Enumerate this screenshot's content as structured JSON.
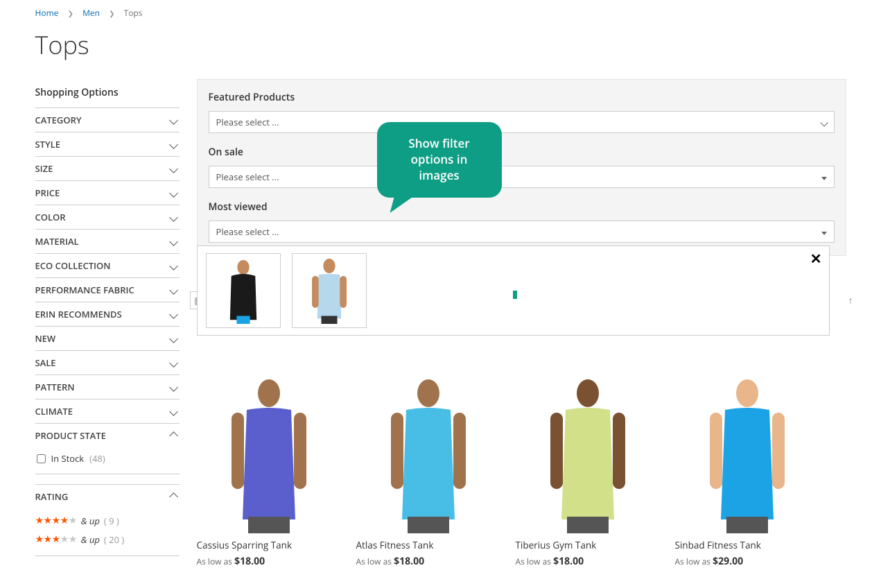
{
  "breadcrumb": {
    "home": "Home",
    "men": "Men",
    "current": "Tops"
  },
  "title": "Tops",
  "sidebar": {
    "heading": "Shopping Options",
    "filters": [
      {
        "label": "CATEGORY",
        "expanded": false
      },
      {
        "label": "STYLE",
        "expanded": false
      },
      {
        "label": "SIZE",
        "expanded": false
      },
      {
        "label": "PRICE",
        "expanded": false
      },
      {
        "label": "COLOR",
        "expanded": false
      },
      {
        "label": "MATERIAL",
        "expanded": false
      },
      {
        "label": "ECO COLLECTION",
        "expanded": false
      },
      {
        "label": "PERFORMANCE FABRIC",
        "expanded": false
      },
      {
        "label": "ERIN RECOMMENDS",
        "expanded": false
      },
      {
        "label": "NEW",
        "expanded": false
      },
      {
        "label": "SALE",
        "expanded": false
      },
      {
        "label": "PATTERN",
        "expanded": false
      },
      {
        "label": "CLIMATE",
        "expanded": false
      }
    ],
    "product_state": {
      "label": "PRODUCT STATE",
      "option_label": "In Stock",
      "option_count": "(48)"
    },
    "rating": {
      "label": "RATING",
      "rows": [
        {
          "stars": 4,
          "label": "& up",
          "count": "( 9 )"
        },
        {
          "stars": 3,
          "label": "& up",
          "count": "( 20 )"
        }
      ]
    }
  },
  "filter_panel": {
    "groups": [
      {
        "label": "Featured Products",
        "placeholder": "Please select ...",
        "arrow": "chev"
      },
      {
        "label": "On sale",
        "placeholder": "Please select ...",
        "arrow": "tri"
      },
      {
        "label": "Most viewed",
        "placeholder": "Please select ...",
        "arrow": "tri"
      }
    ]
  },
  "tooltip_text": "Show filter options in images",
  "products": [
    {
      "name": "Cassius Sparring Tank",
      "prefix": "As low as",
      "price": "$18.00",
      "shirt": "#5b5fce",
      "skin": "#a0734d"
    },
    {
      "name": "Atlas Fitness Tank",
      "prefix": "As low as",
      "price": "$18.00",
      "shirt": "#48bde6",
      "skin": "#a0734d"
    },
    {
      "name": "Tiberius Gym Tank",
      "prefix": "As low as",
      "price": "$18.00",
      "shirt": "#d1e089",
      "skin": "#7a5131"
    },
    {
      "name": "Sinbad Fitness Tank",
      "prefix": "As low as",
      "price": "$29.00",
      "shirt": "#1ca3e6",
      "skin": "#e8b68a"
    }
  ]
}
